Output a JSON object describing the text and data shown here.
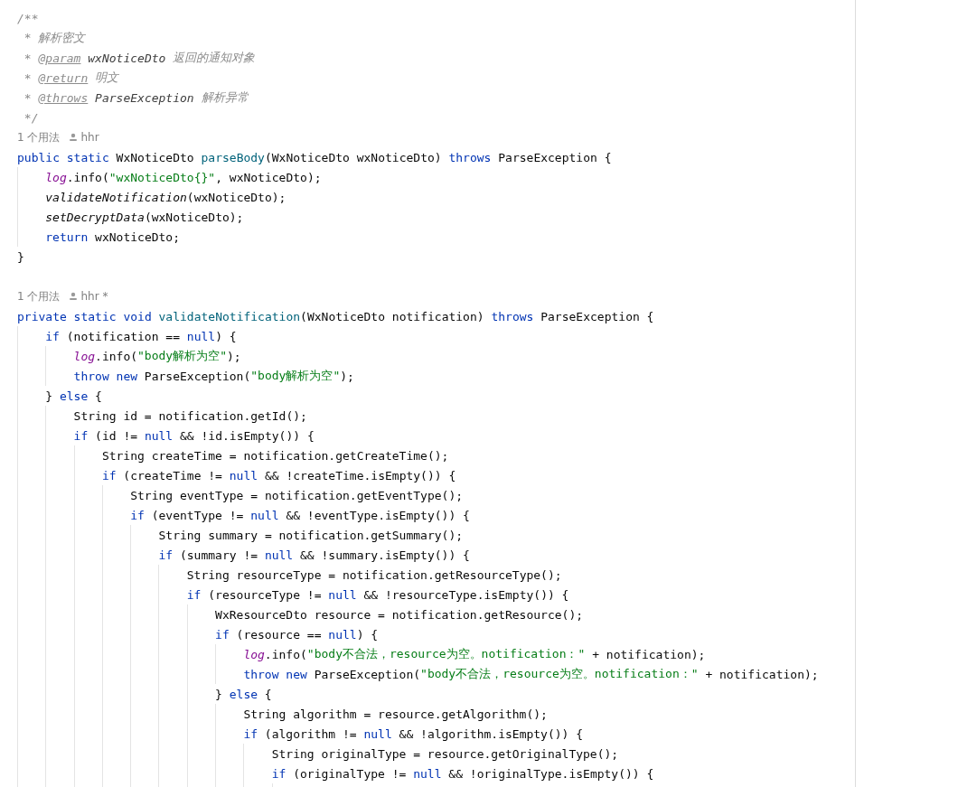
{
  "editor": {
    "lines": [
      {
        "kind": "code",
        "tokens": [
          {
            "kind": "comment",
            "t": "/**"
          }
        ]
      },
      {
        "kind": "code",
        "tokens": [
          {
            "kind": "comment",
            "t": " * 解析密文"
          }
        ]
      },
      {
        "kind": "code",
        "tokens": [
          {
            "kind": "comment",
            "t": " * "
          },
          {
            "kind": "tag",
            "t": "@param"
          },
          {
            "kind": "docref",
            "t": " wxNoticeDto"
          },
          {
            "kind": "comment",
            "t": " 返回的通知对象"
          }
        ]
      },
      {
        "kind": "code",
        "tokens": [
          {
            "kind": "comment",
            "t": " * "
          },
          {
            "kind": "tag",
            "t": "@return"
          },
          {
            "kind": "comment",
            "t": " 明文"
          }
        ]
      },
      {
        "kind": "code",
        "tokens": [
          {
            "kind": "comment",
            "t": " * "
          },
          {
            "kind": "tag",
            "t": "@throws"
          },
          {
            "kind": "docref",
            "t": " ParseException"
          },
          {
            "kind": "comment",
            "t": " 解析异常"
          }
        ]
      },
      {
        "kind": "code",
        "tokens": [
          {
            "kind": "comment",
            "t": " */"
          }
        ]
      },
      {
        "kind": "hint",
        "usages": "1 个用法",
        "author": "hhr"
      },
      {
        "kind": "code",
        "tokens": [
          {
            "kind": "kw",
            "t": "public static "
          },
          {
            "kind": "plain",
            "t": "WxNoticeDto "
          },
          {
            "kind": "decl",
            "t": "parseBody"
          },
          {
            "kind": "plain",
            "t": "(WxNoticeDto wxNoticeDto) "
          },
          {
            "kind": "kw",
            "t": "throws "
          },
          {
            "kind": "plain",
            "t": "ParseException {"
          }
        ]
      },
      {
        "kind": "code",
        "tokens": [
          {
            "kind": "field",
            "t": "    log"
          },
          {
            "kind": "plain",
            "t": ".info("
          },
          {
            "kind": "str",
            "t": "\"wxNoticeDto{}\""
          },
          {
            "kind": "plain",
            "t": ", wxNoticeDto);"
          }
        ]
      },
      {
        "kind": "code",
        "tokens": [
          {
            "kind": "italic",
            "t": "    validateNotification"
          },
          {
            "kind": "plain",
            "t": "(wxNoticeDto);"
          }
        ]
      },
      {
        "kind": "code",
        "tokens": [
          {
            "kind": "italic",
            "t": "    setDecryptData"
          },
          {
            "kind": "plain",
            "t": "(wxNoticeDto);"
          }
        ]
      },
      {
        "kind": "code",
        "tokens": [
          {
            "kind": "kw",
            "t": "    return"
          },
          {
            "kind": "plain",
            "t": " wxNoticeDto;"
          }
        ]
      },
      {
        "kind": "code",
        "tokens": [
          {
            "kind": "plain",
            "t": "}"
          }
        ]
      },
      {
        "kind": "blank"
      },
      {
        "kind": "hint",
        "usages": "1 个用法",
        "author": "hhr *"
      },
      {
        "kind": "code",
        "tokens": [
          {
            "kind": "kw",
            "t": "private static void "
          },
          {
            "kind": "decl",
            "t": "validateNotification"
          },
          {
            "kind": "plain",
            "t": "(WxNoticeDto notification) "
          },
          {
            "kind": "kw",
            "t": "throws"
          },
          {
            "kind": "plain",
            "t": " ParseException {"
          }
        ]
      },
      {
        "kind": "code",
        "tokens": [
          {
            "kind": "kw",
            "t": "    if"
          },
          {
            "kind": "plain",
            "t": " (notification == "
          },
          {
            "kind": "kw",
            "t": "null"
          },
          {
            "kind": "plain",
            "t": ") {"
          }
        ]
      },
      {
        "kind": "code",
        "tokens": [
          {
            "kind": "field",
            "t": "        log"
          },
          {
            "kind": "plain",
            "t": ".info("
          },
          {
            "kind": "str",
            "t": "\"body解析为空\""
          },
          {
            "kind": "plain",
            "t": ");"
          }
        ]
      },
      {
        "kind": "code",
        "tokens": [
          {
            "kind": "kw",
            "t": "        throw new"
          },
          {
            "kind": "plain",
            "t": " ParseException("
          },
          {
            "kind": "str",
            "t": "\"body解析为空\""
          },
          {
            "kind": "plain",
            "t": ");"
          }
        ]
      },
      {
        "kind": "code",
        "tokens": [
          {
            "kind": "plain",
            "t": "    } "
          },
          {
            "kind": "kw",
            "t": "else"
          },
          {
            "kind": "plain",
            "t": " {"
          }
        ]
      },
      {
        "kind": "code",
        "tokens": [
          {
            "kind": "plain",
            "t": "        String id = notification.getId();"
          }
        ]
      },
      {
        "kind": "code",
        "tokens": [
          {
            "kind": "kw",
            "t": "        if"
          },
          {
            "kind": "plain",
            "t": " (id != "
          },
          {
            "kind": "kw",
            "t": "null"
          },
          {
            "kind": "plain",
            "t": " && !id.isEmpty()) {"
          }
        ]
      },
      {
        "kind": "code",
        "tokens": [
          {
            "kind": "plain",
            "t": "            String createTime = notification.getCreateTime();"
          }
        ]
      },
      {
        "kind": "code",
        "tokens": [
          {
            "kind": "kw",
            "t": "            if"
          },
          {
            "kind": "plain",
            "t": " (createTime != "
          },
          {
            "kind": "kw",
            "t": "null"
          },
          {
            "kind": "plain",
            "t": " && !createTime.isEmpty()) {"
          }
        ]
      },
      {
        "kind": "code",
        "tokens": [
          {
            "kind": "plain",
            "t": "                String eventType = notification.getEventType();"
          }
        ]
      },
      {
        "kind": "code",
        "tokens": [
          {
            "kind": "kw",
            "t": "                if"
          },
          {
            "kind": "plain",
            "t": " (eventType != "
          },
          {
            "kind": "kw",
            "t": "null"
          },
          {
            "kind": "plain",
            "t": " && !eventType.isEmpty()) {"
          }
        ]
      },
      {
        "kind": "code",
        "tokens": [
          {
            "kind": "plain",
            "t": "                    String summary = notification.getSummary();"
          }
        ]
      },
      {
        "kind": "code",
        "tokens": [
          {
            "kind": "kw",
            "t": "                    if"
          },
          {
            "kind": "plain",
            "t": " (summary != "
          },
          {
            "kind": "kw",
            "t": "null"
          },
          {
            "kind": "plain",
            "t": " && !summary.isEmpty()) {"
          }
        ]
      },
      {
        "kind": "code",
        "tokens": [
          {
            "kind": "plain",
            "t": "                        String resourceType = notification.getResourceType();"
          }
        ]
      },
      {
        "kind": "code",
        "tokens": [
          {
            "kind": "kw",
            "t": "                        if"
          },
          {
            "kind": "plain",
            "t": " (resourceType != "
          },
          {
            "kind": "kw",
            "t": "null"
          },
          {
            "kind": "plain",
            "t": " && !resourceType.isEmpty()) {"
          }
        ]
      },
      {
        "kind": "code",
        "tokens": [
          {
            "kind": "plain",
            "t": "                            WxResourceDto resource = notification.getResource();"
          }
        ]
      },
      {
        "kind": "code",
        "tokens": [
          {
            "kind": "kw",
            "t": "                            if"
          },
          {
            "kind": "plain",
            "t": " (resource == "
          },
          {
            "kind": "kw",
            "t": "null"
          },
          {
            "kind": "plain",
            "t": ") {"
          }
        ]
      },
      {
        "kind": "code",
        "tokens": [
          {
            "kind": "field",
            "t": "                                log"
          },
          {
            "kind": "plain",
            "t": ".info("
          },
          {
            "kind": "str",
            "t": "\"body不合法，resource为空。notification：\""
          },
          {
            "kind": "plain",
            "t": " + notification);"
          }
        ]
      },
      {
        "kind": "code",
        "tokens": [
          {
            "kind": "kw",
            "t": "                                throw new"
          },
          {
            "kind": "plain",
            "t": " ParseException("
          },
          {
            "kind": "str",
            "t": "\"body不合法，resource为空。notification：\""
          },
          {
            "kind": "plain",
            "t": " + notification);"
          }
        ]
      },
      {
        "kind": "code",
        "tokens": [
          {
            "kind": "plain",
            "t": "                            } "
          },
          {
            "kind": "kw",
            "t": "else"
          },
          {
            "kind": "plain",
            "t": " {"
          }
        ]
      },
      {
        "kind": "code",
        "tokens": [
          {
            "kind": "plain",
            "t": "                                String algorithm = resource.getAlgorithm();"
          }
        ]
      },
      {
        "kind": "code",
        "tokens": [
          {
            "kind": "kw",
            "t": "                                if"
          },
          {
            "kind": "plain",
            "t": " (algorithm != "
          },
          {
            "kind": "kw",
            "t": "null"
          },
          {
            "kind": "plain",
            "t": " && !algorithm.isEmpty()) {"
          }
        ]
      },
      {
        "kind": "code",
        "tokens": [
          {
            "kind": "plain",
            "t": "                                    String originalType = resource.getOriginalType();"
          }
        ]
      },
      {
        "kind": "code",
        "tokens": [
          {
            "kind": "kw",
            "t": "                                    if"
          },
          {
            "kind": "plain",
            "t": " (originalType != "
          },
          {
            "kind": "kw",
            "t": "null"
          },
          {
            "kind": "plain",
            "t": " && !originalType.isEmpty()) {"
          }
        ]
      }
    ]
  }
}
